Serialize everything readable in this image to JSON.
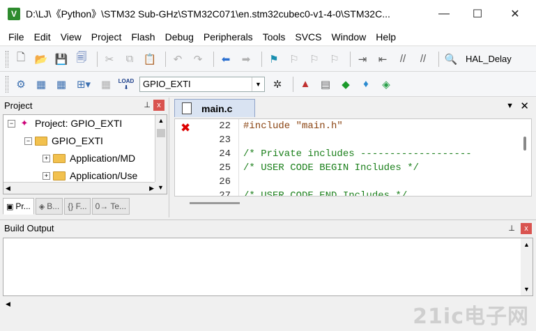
{
  "window": {
    "title": "D:\\LJ\\《Python》\\STM32 Sub-GHz\\STM32C071\\en.stm32cubec0-v1-4-0\\STM32C...",
    "app_icon": "keil-uvision-icon",
    "minimize": "—",
    "maximize": "☐",
    "close": "✕"
  },
  "menu": [
    "File",
    "Edit",
    "View",
    "Project",
    "Flash",
    "Debug",
    "Peripherals",
    "Tools",
    "SVCS",
    "Window",
    "Help"
  ],
  "toolbar": {
    "find_text": "HAL_Delay"
  },
  "build_toolbar": {
    "target": "GPIO_EXTI",
    "load_label": "LOAD"
  },
  "project_panel": {
    "title": "Project",
    "pin": "📌",
    "close": "x",
    "tree": [
      {
        "label": "Project: GPIO_EXTI",
        "expander": "−"
      },
      {
        "label": "GPIO_EXTI",
        "expander": "−"
      },
      {
        "label": "Application/MD",
        "expander": "+"
      },
      {
        "label": "Application/Use",
        "expander": "+"
      }
    ],
    "tabs": [
      "Pr...",
      "B...",
      "{} F...",
      "0→ Te..."
    ]
  },
  "editor": {
    "tab": "main.c",
    "dropdown": "▼",
    "close": "✕",
    "error_marker": "✖",
    "lines": [
      {
        "n": "22",
        "text": "#include \"main.h\""
      },
      {
        "n": "23",
        "text": ""
      },
      {
        "n": "24",
        "text": "/* Private includes -------------------"
      },
      {
        "n": "25",
        "text": "/* USER CODE BEGIN Includes */"
      },
      {
        "n": "26",
        "text": ""
      },
      {
        "n": "27",
        "text": "/* USER CODE END Includes */"
      }
    ]
  },
  "build_output": {
    "title": "Build Output",
    "pin": "📌",
    "close": "x"
  },
  "watermark": "21ic电子网"
}
